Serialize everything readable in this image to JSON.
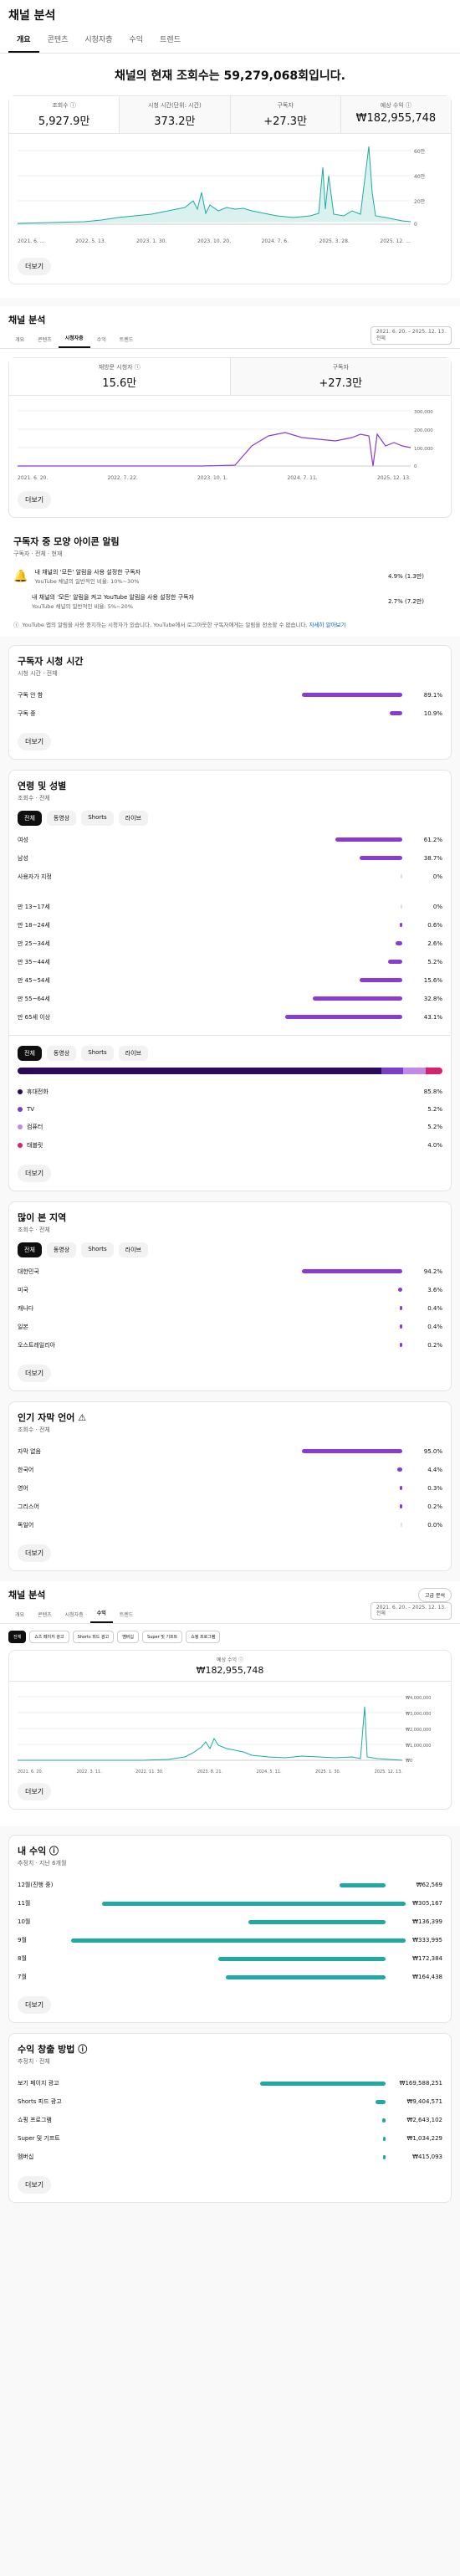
{
  "page": {
    "title": "채널 분석",
    "tabs": [
      "개요",
      "콘텐츠",
      "시청자층",
      "수익",
      "트렌드"
    ],
    "headline": "채널의 현재 조회수는 59,279,068회입니다.",
    "metrics": [
      {
        "label": "조회수 ⓘ",
        "value": "5,927.9만"
      },
      {
        "label": "시청 시간(단위: 시간)",
        "value": "373.2만"
      },
      {
        "label": "구독자",
        "value": "+27.3만"
      },
      {
        "label": "예상 수익 ⓘ",
        "value": "₩182,955,748"
      }
    ],
    "overview_chart": {
      "x_ticks": [
        "2021. 6. …",
        "2022. 5. 13.",
        "2023. 1. 30.",
        "2023. 10. 20.",
        "2024. 7. 6.",
        "2025. 3. 28.",
        "2025. 12. …"
      ],
      "y_ticks": [
        "60만",
        "40만",
        "20만",
        "0"
      ]
    },
    "more_label": "더보기"
  },
  "audience": {
    "title": "채널 분석",
    "tabs": [
      "개요",
      "콘텐츠",
      "시청자층",
      "수익",
      "트렌드"
    ],
    "range_line1": "2021. 6. 20. – 2025. 12. 13.",
    "range_line2": "전체",
    "metrics": [
      {
        "label": "재방문 시청자 ⓘ",
        "value": "15.6만"
      },
      {
        "label": "구독자",
        "value": "+27.3만"
      }
    ],
    "chart": {
      "x_ticks": [
        "2021. 6. 20.",
        "2022. 7. 22.",
        "2023. 10. 1.",
        "2024. 7. 11.",
        "2025. 12. 13."
      ],
      "y_ticks": [
        "300,000",
        "200,000",
        "100,000",
        "0"
      ]
    },
    "bell": {
      "title": "구독자 중 모양 아이콘 알림",
      "sub": "구독자 · 전체 · 현재",
      "row1_text": "내 채널의 '모든' 알림을 사용 설정한 구독자",
      "row1_sub": "YouTube 채널의 일반적인 비율: 10%~30%",
      "row1_val": "4.9% (1.3만)",
      "row2_text": "내 채널의 '모든' 알림을 켜고 YouTube 알림을 사용 설정한 구독자",
      "row2_sub": "YouTube 채널의 일반적인 비율: 5%~20%",
      "row2_val": "2.7% (7.2만)",
      "note": "YouTube 앱의 알림을 사용 중지하는 시청자가 있습니다. YouTube에서 로그아웃한 구독자에게는 알림을 전송할 수 없습니다.",
      "note_link": "자세히 알아보기"
    },
    "watch_time": {
      "title": "구독자 시청 시간",
      "sub": "시청 시간 · 전체",
      "rows": [
        {
          "name": "구독 안 함",
          "pct": "89.1%",
          "w": 0.891
        },
        {
          "name": "구독 중",
          "pct": "10.9%",
          "w": 0.109
        }
      ]
    },
    "age_gender": {
      "title": "연령 및 성별",
      "sub": "조회수 · 전체",
      "pills": [
        "전체",
        "동영상",
        "Shorts",
        "라이브"
      ],
      "gender": [
        {
          "name": "여성",
          "pct": "61.2%",
          "w": 0.612
        },
        {
          "name": "남성",
          "pct": "38.7%",
          "w": 0.387
        },
        {
          "name": "사용자가 지정",
          "pct": "0%",
          "w": 0.0
        }
      ],
      "ages": [
        {
          "name": "만 13~17세",
          "pct": "0%",
          "w": 0.0
        },
        {
          "name": "만 18~24세",
          "pct": "0.6%",
          "w": 0.006
        },
        {
          "name": "만 25~34세",
          "pct": "2.6%",
          "w": 0.026
        },
        {
          "name": "만 35~44세",
          "pct": "5.2%",
          "w": 0.052
        },
        {
          "name": "만 45~54세",
          "pct": "15.6%",
          "w": 0.156
        },
        {
          "name": "만 55~64세",
          "pct": "32.8%",
          "w": 0.328
        },
        {
          "name": "만 65세 이상",
          "pct": "43.1%",
          "w": 0.431
        }
      ]
    },
    "device": {
      "pills": [
        "전체",
        "동영상",
        "Shorts",
        "라이브"
      ],
      "rows": [
        {
          "name": "휴대전화",
          "pct": "85.8%",
          "color": "#2b0a57"
        },
        {
          "name": "TV",
          "pct": "5.2%",
          "color": "#7a3fc7"
        },
        {
          "name": "컴퓨터",
          "pct": "5.2%",
          "color": "#c18ae6"
        },
        {
          "name": "태블릿",
          "pct": "4.0%",
          "color": "#d5246e"
        }
      ],
      "stack": [
        0.858,
        0.052,
        0.052,
        0.04
      ]
    },
    "geo": {
      "title": "많이 본 지역",
      "sub": "조회수 · 전체",
      "pills": [
        "전체",
        "동영상",
        "Shorts",
        "라이브"
      ],
      "rows": [
        {
          "name": "대한민국",
          "pct": "94.2%",
          "w": 0.942
        },
        {
          "name": "미국",
          "pct": "3.6%",
          "w": 0.036
        },
        {
          "name": "캐나다",
          "pct": "0.4%",
          "w": 0.004
        },
        {
          "name": "일본",
          "pct": "0.4%",
          "w": 0.004
        },
        {
          "name": "오스트레일리아",
          "pct": "0.2%",
          "w": 0.002
        }
      ]
    },
    "subs_lang": {
      "title": "인기 자막 언어 ⚠",
      "sub": "조회수 · 전체",
      "rows": [
        {
          "name": "자막 없음",
          "pct": "95.0%",
          "w": 0.95
        },
        {
          "name": "한국어",
          "pct": "4.4%",
          "w": 0.044
        },
        {
          "name": "영어",
          "pct": "0.3%",
          "w": 0.003
        },
        {
          "name": "그리스어",
          "pct": "0.2%",
          "w": 0.002
        },
        {
          "name": "독일어",
          "pct": "0.0%",
          "w": 0.0
        }
      ]
    },
    "more_label": "더보기"
  },
  "revenue": {
    "title": "채널 분석",
    "export_label": "고급 분석",
    "tabs": [
      "개요",
      "콘텐츠",
      "시청자층",
      "수익",
      "트렌드"
    ],
    "range_line1": "2021. 6. 20. – 2025. 12. 13.",
    "range_line2": "전체",
    "chips": [
      "전체",
      "쇼츠 페이지 광고",
      "Shorts 피드 광고",
      "멤버십",
      "Super 및 기프트",
      "쇼핑 프로그램"
    ],
    "metric_label": "예상 수익 ⓘ",
    "metric_value": "₩182,955,748",
    "chart": {
      "x_ticks": [
        "2021. 6. 20.",
        "2022. 3. 11.",
        "2022. 11. 30.",
        "2023. 8. 21.",
        "2024. 5. 11.",
        "2025. 1. 30.",
        "2025. 12. 13."
      ],
      "y_ticks": [
        "₩4,000,000",
        "₩3,000,000",
        "₩2,000,000",
        "₩1,000,000",
        "₩0"
      ]
    },
    "my_revenue": {
      "title": "내 수익 ⓘ",
      "sub": "추정치 · 지난 6개월",
      "rows": [
        {
          "name": "12월(진행 중)",
          "pct": "₩62,569",
          "w": 0.03
        },
        {
          "name": "11월",
          "pct": "₩305,167",
          "w": 0.2
        },
        {
          "name": "10월",
          "pct": "₩136,399",
          "w": 0.09
        },
        {
          "name": "9월",
          "pct": "₩333,995",
          "w": 0.22
        },
        {
          "name": "8월",
          "pct": "₩172,384",
          "w": 0.11
        },
        {
          "name": "7월",
          "pct": "₩164,438",
          "w": 0.105
        }
      ]
    },
    "sources": {
      "title": "수익 창출 방법 ⓘ",
      "sub": "추정치 · 전체",
      "rows": [
        {
          "name": "보기 페이지 광고",
          "pct": "₩169,588,251",
          "w": 0.6
        },
        {
          "name": "Shorts 피드 광고",
          "pct": "₩9,404,571",
          "w": 0.05
        },
        {
          "name": "쇼핑 프로그램",
          "pct": "₩2,643,102",
          "w": 0.018
        },
        {
          "name": "Super 및 기프트",
          "pct": "₩1,034,229",
          "w": 0.008
        },
        {
          "name": "멤버십",
          "pct": "₩415,093",
          "w": 0.004
        }
      ]
    },
    "more_label": "더보기"
  },
  "colors": {
    "teal": "#1fa9a0",
    "purple": "#8a3ccf",
    "dark": "#0f0f0f"
  }
}
